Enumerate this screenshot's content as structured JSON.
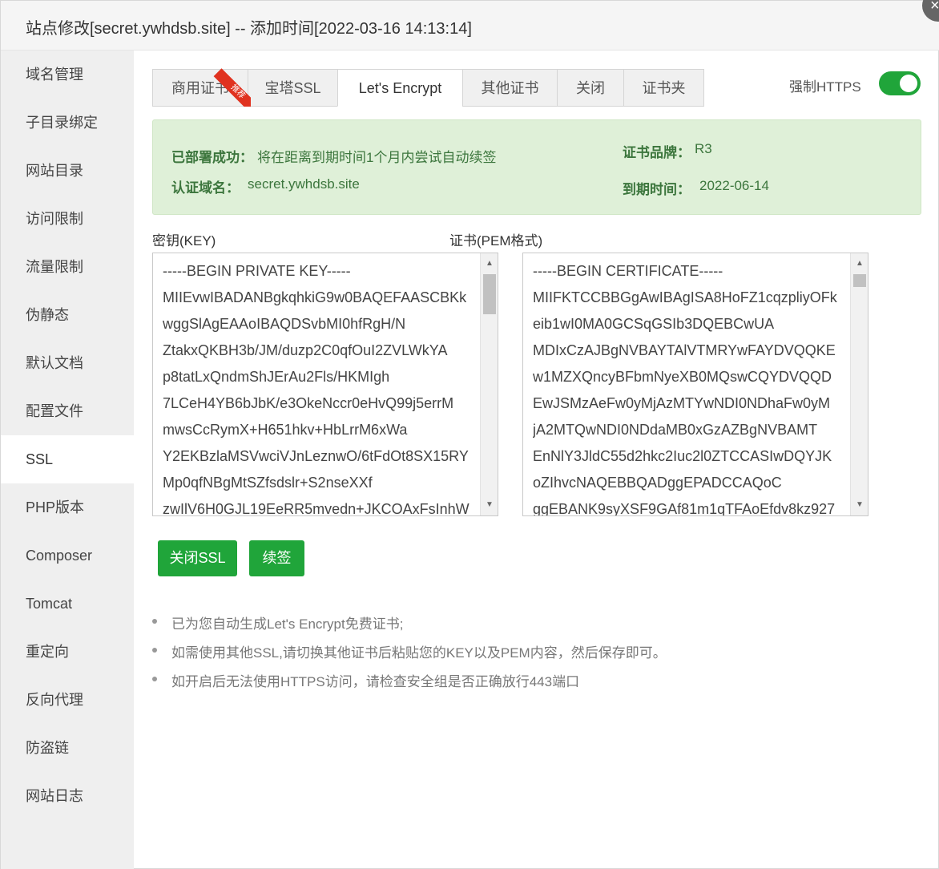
{
  "window": {
    "title": "站点修改[secret.ywhdsb.site] -- 添加时间[2022-03-16 14:13:14]",
    "close_icon": "×"
  },
  "sidebar": {
    "items": [
      {
        "label": "域名管理"
      },
      {
        "label": "子目录绑定"
      },
      {
        "label": "网站目录"
      },
      {
        "label": "访问限制"
      },
      {
        "label": "流量限制"
      },
      {
        "label": "伪静态"
      },
      {
        "label": "默认文档"
      },
      {
        "label": "配置文件"
      },
      {
        "label": "SSL",
        "active": true
      },
      {
        "label": "PHP版本"
      },
      {
        "label": "Composer"
      },
      {
        "label": "Tomcat"
      },
      {
        "label": "重定向"
      },
      {
        "label": "反向代理"
      },
      {
        "label": "防盗链"
      },
      {
        "label": "网站日志"
      }
    ]
  },
  "tabs": {
    "items": [
      {
        "label": "商用证书"
      },
      {
        "label": "宝塔SSL"
      },
      {
        "label": "Let's Encrypt",
        "active": true
      },
      {
        "label": "其他证书"
      },
      {
        "label": "关闭"
      },
      {
        "label": "证书夹"
      }
    ],
    "ribbon_label": "推荐"
  },
  "force_https": {
    "label": "强制HTTPS",
    "enabled": true,
    "color": "#20a53a"
  },
  "status": {
    "deployed_key": "已部署成功：",
    "deployed_value": "将在距离到期时间1个月内尝试自动续签",
    "domain_key": "认证域名：",
    "domain_value": "secret.ywhdsb.site",
    "brand_key": "证书品牌：",
    "brand_value": "R3",
    "expire_key": "到期时间：",
    "expire_value": "2022-06-14"
  },
  "key_box": {
    "label": "密钥(KEY)",
    "lines": [
      "-----BEGIN PRIVATE KEY-----",
      "MIIEvwIBADANBgkqhkiG9w0BAQEFAASCBKk",
      "wggSlAgEAAoIBAQDSvbMI0hfRgH/N",
      "ZtakxQKBH3b/JM/duzp2C0qfOuI2ZVLWkYA",
      "p8tatLxQndmShJErAu2Fls/HKMIgh",
      "7LCeH4YB6bJbK/e3OkeNccr0eHvQ99j5errM",
      "mwsCcRymX+H651hkv+HbLrrM6xWa",
      "Y2EKBzlaMSVwciVJnLeznwO/6tFdOt8SX15RY",
      "Mp0qfNBgMtSZfsdslr+S2nseXXf",
      "zwIlV6H0GJL19EeRR5mvedn+JKCOAxFsInhW"
    ],
    "scroll_fraction": 0.0
  },
  "cert_box": {
    "label": "证书(PEM格式)",
    "lines": [
      "-----BEGIN CERTIFICATE-----",
      "MIIFKTCCBBGgAwIBAgISA8HoFZ1cqzpliyOFk",
      "eib1wI0MA0GCSqGSIb3DQEBCwUA",
      "MDIxCzAJBgNVBAYTAlVTMRYwFAYDVQQKE",
      "w1MZXQncyBFbmNyeXB0MQswCQYDVQQD",
      "EwJSMzAeFw0yMjAzMTYwNDI0NDhaFw0yM",
      "jA2MTQwNDI0NDdaMB0xGzAZBgNVBAMT",
      "EnNlY3JldC55d2hkc2Iuc2l0ZTCCASIwDQYJK",
      "oZIhvcNAQEBBQADggEPADCCAQoC",
      "ggEBANK9syXSF9GAf81m1qTFAoEfdv8kz927"
    ],
    "scroll_fraction": 0.0
  },
  "buttons": {
    "close_ssl": "关闭SSL",
    "renew": "续签"
  },
  "tips": [
    "已为您自动生成Let's Encrypt免费证书;",
    "如需使用其他SSL,请切换其他证书后粘贴您的KEY以及PEM内容，然后保存即可。",
    "如开启后无法使用HTTPS访问，请检查安全组是否正确放行443端口"
  ],
  "colors": {
    "accent": "#20a53a",
    "alert_bg": "#dff0d8",
    "alert_text": "#3c763d",
    "ribbon": "#e0321f"
  }
}
